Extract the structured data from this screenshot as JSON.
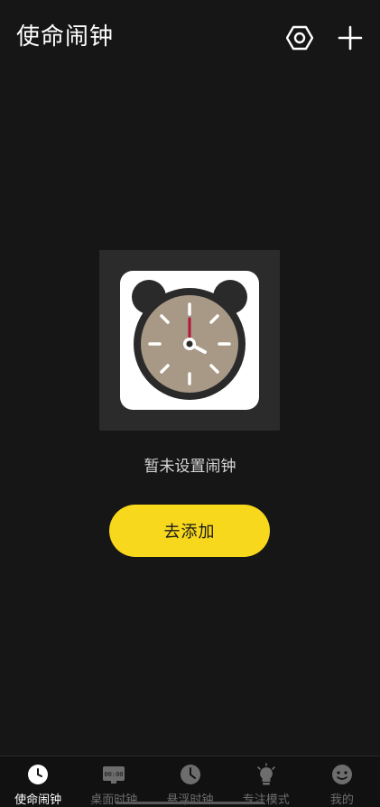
{
  "header": {
    "title": "使命闹钟",
    "settings_icon": "hexagon-settings-icon",
    "add_icon": "plus-icon"
  },
  "empty_state": {
    "message": "暂未设置闹钟",
    "button_label": "去添加"
  },
  "tabs": [
    {
      "label": "使命闹钟",
      "icon": "alarm-clock-icon",
      "active": true
    },
    {
      "label": "桌面时钟",
      "icon": "desk-clock-icon",
      "active": false
    },
    {
      "label": "悬浮时钟",
      "icon": "floating-clock-icon",
      "active": false
    },
    {
      "label": "专注模式",
      "icon": "lightbulb-icon",
      "active": false
    },
    {
      "label": "我的",
      "icon": "profile-icon",
      "active": false
    }
  ],
  "colors": {
    "background": "#161616",
    "accent": "#f7d81c",
    "clock_face": "#a89886",
    "second_hand": "#b3153b"
  }
}
